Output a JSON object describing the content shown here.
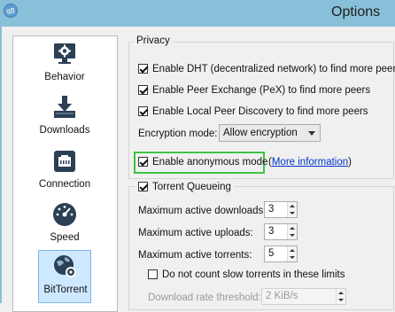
{
  "window": {
    "title": "Options",
    "app_icon": "qB"
  },
  "sidebar": {
    "items": [
      {
        "label": "Behavior",
        "icon": "monitor-gear-icon"
      },
      {
        "label": "Downloads",
        "icon": "download-tray-icon"
      },
      {
        "label": "Connection",
        "icon": "network-port-icon"
      },
      {
        "label": "Speed",
        "icon": "speedometer-icon"
      },
      {
        "label": "BitTorrent",
        "icon": "globe-gear-icon",
        "selected": true
      }
    ]
  },
  "privacy": {
    "title": "Privacy",
    "dht_label": "Enable DHT (decentralized network) to find more peers",
    "dht_checked": true,
    "pex_label": "Enable Peer Exchange (PeX) to find more peers",
    "pex_checked": true,
    "lpd_label": "Enable Local Peer Discovery to find more peers",
    "lpd_checked": true,
    "encryption_label": "Encryption mode:",
    "encryption_value": "Allow encryption",
    "anonymous_label": "Enable anonymous mode",
    "anonymous_checked": true,
    "more_info_open": "(",
    "more_info_link": "More information",
    "more_info_close": ")"
  },
  "queueing": {
    "title": "Torrent Queueing",
    "enabled": true,
    "max_downloads_label": "Maximum active downloads:",
    "max_downloads_value": "3",
    "max_uploads_label": "Maximum active uploads:",
    "max_uploads_value": "3",
    "max_torrents_label": "Maximum active torrents:",
    "max_torrents_value": "5",
    "slow_label": "Do not count slow torrents in these limits",
    "slow_checked": false,
    "dl_threshold_label": "Download rate threshold:",
    "dl_threshold_value": "2 KiB/s"
  },
  "colors": {
    "titlebar": "#89c0d9",
    "highlight": "#3fc33f",
    "link": "#0033cc",
    "selected_bg": "#cde8ff"
  }
}
